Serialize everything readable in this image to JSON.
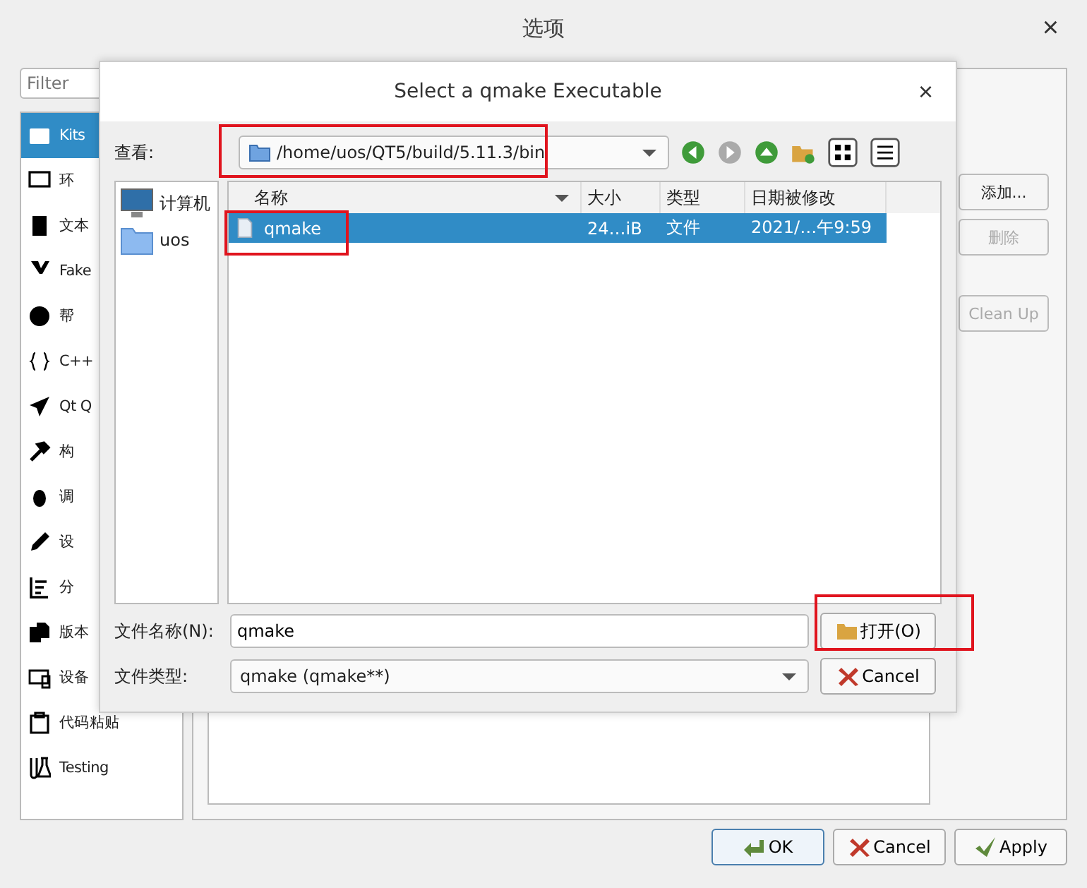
{
  "window": {
    "title": "选项",
    "close": "×"
  },
  "filter": {
    "placeholder": "Filter"
  },
  "sidebar": {
    "items": [
      {
        "label": "Kits",
        "selected": true
      },
      {
        "label": "环",
        "selected": false
      },
      {
        "label": "文本",
        "selected": false
      },
      {
        "label": "Fake",
        "selected": false
      },
      {
        "label": "帮",
        "selected": false
      },
      {
        "label": "C++",
        "selected": false
      },
      {
        "label": "Qt Q",
        "selected": false
      },
      {
        "label": "构",
        "selected": false
      },
      {
        "label": "调",
        "selected": false
      },
      {
        "label": "设",
        "selected": false
      },
      {
        "label": "分",
        "selected": false
      },
      {
        "label": "版本",
        "selected": false
      },
      {
        "label": "设备",
        "selected": false
      },
      {
        "label": "代码粘贴",
        "selected": false
      },
      {
        "label": "Testing",
        "selected": false
      }
    ]
  },
  "side_buttons": [
    {
      "label": "添加...",
      "disabled": false
    },
    {
      "label": "删除",
      "disabled": true
    },
    {
      "label": "Clean Up",
      "disabled": true
    }
  ],
  "buttons": [
    {
      "label": "OK",
      "kind": "ok"
    },
    {
      "label": "Cancel",
      "kind": "cancel"
    },
    {
      "label": "Apply",
      "kind": "apply"
    }
  ],
  "dialog": {
    "title": "Select a qmake Executable",
    "close": "×",
    "look_in": {
      "label": "查看:",
      "path": "/home/uos/QT5/build/5.11.3/bin",
      "highlighted": true
    },
    "places": [
      {
        "label": "计算机",
        "kind": "computer"
      },
      {
        "label": "uos",
        "kind": "folder"
      }
    ],
    "columns": [
      "名称",
      "大小",
      "类型",
      "日期被修改"
    ],
    "rows": [
      {
        "name": "qmake",
        "size": "24…iB",
        "type": "文件",
        "modified": "2021/…午9:59",
        "selected": true,
        "highlighted": true
      }
    ],
    "file_name": {
      "label": "文件名称(N):",
      "value": "qmake"
    },
    "file_type": {
      "label": "文件类型:",
      "value": "qmake (qmake**)"
    },
    "open_button": {
      "label": "打开(O)",
      "highlighted": true
    },
    "cancel_button": {
      "label": "Cancel"
    }
  }
}
